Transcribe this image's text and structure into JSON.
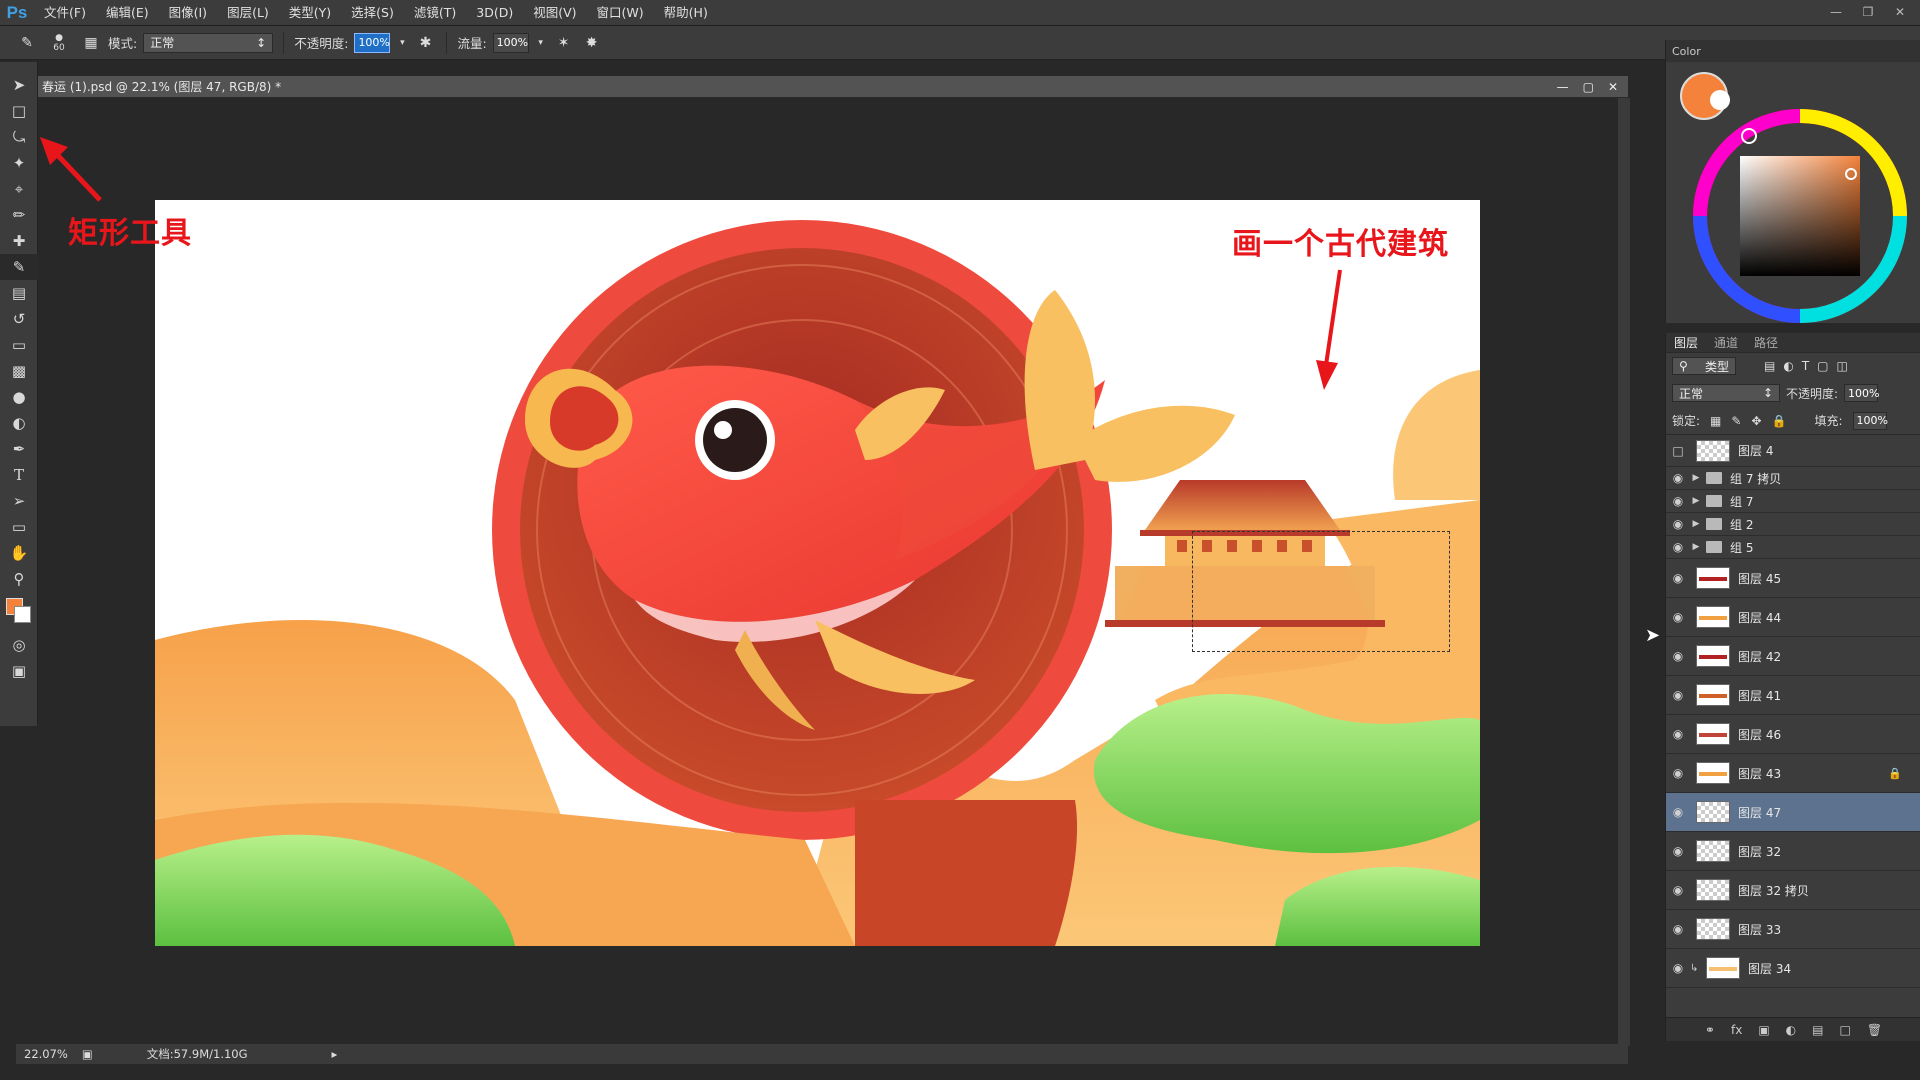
{
  "app": {
    "logo": "Ps"
  },
  "menu": [
    "文件(F)",
    "编辑(E)",
    "图像(I)",
    "图层(L)",
    "类型(Y)",
    "选择(S)",
    "滤镜(T)",
    "3D(D)",
    "视图(V)",
    "窗口(W)",
    "帮助(H)"
  ],
  "options": {
    "brush_size": "60",
    "mode_label": "模式:",
    "mode_value": "正常",
    "opacity_label": "不透明度:",
    "opacity_value": "100%",
    "flow_label": "流量:",
    "flow_value": "100%"
  },
  "document": {
    "tab_title": "春运 (1).psd @ 22.1% (图层 47, RGB/8) *",
    "zoom": "22.07%",
    "doc_size": "文档:57.9M/1.10G"
  },
  "annotations": {
    "tool_label": "矩形工具",
    "draw_label": "画一个古代建筑"
  },
  "color_panel": {
    "title": "Color"
  },
  "layers_panel": {
    "tabs": [
      "图层",
      "通道",
      "路径"
    ],
    "filter_label": "类型",
    "blend_mode": "正常",
    "opacity_label": "不透明度:",
    "opacity_value": "100%",
    "lock_label": "锁定:",
    "fill_label": "填充:",
    "fill_value": "100%",
    "layers": [
      {
        "name": "图层 4",
        "type": "layer",
        "visible": false
      },
      {
        "name": "组 7 拷贝",
        "type": "group",
        "visible": true
      },
      {
        "name": "组 7",
        "type": "group",
        "visible": true
      },
      {
        "name": "组 2",
        "type": "group",
        "visible": true
      },
      {
        "name": "组 5",
        "type": "group",
        "visible": true
      },
      {
        "name": "图层 45",
        "type": "layer",
        "visible": true,
        "color": "#b22222"
      },
      {
        "name": "图层 44",
        "type": "layer",
        "visible": true,
        "color": "#f0a040"
      },
      {
        "name": "图层 42",
        "type": "layer",
        "visible": true,
        "color": "#b22222"
      },
      {
        "name": "图层 41",
        "type": "layer",
        "visible": true,
        "color": "#d0602a"
      },
      {
        "name": "图层 46",
        "type": "layer",
        "visible": true,
        "color": "#c0443a"
      },
      {
        "name": "图层 43",
        "type": "layer",
        "visible": true,
        "color": "#f0a040",
        "locked": true
      },
      {
        "name": "图层 47",
        "type": "layer",
        "visible": true,
        "selected": true
      },
      {
        "name": "图层 32",
        "type": "layer",
        "visible": true
      },
      {
        "name": "图层 32 拷贝",
        "type": "layer",
        "visible": true
      },
      {
        "name": "图层 33",
        "type": "layer",
        "visible": true
      },
      {
        "name": "图层 34",
        "type": "layer",
        "visible": true,
        "color": "#f6c070",
        "clipped": true
      }
    ]
  },
  "colors": {
    "foreground": "#f4823a",
    "background": "#ffffff"
  }
}
